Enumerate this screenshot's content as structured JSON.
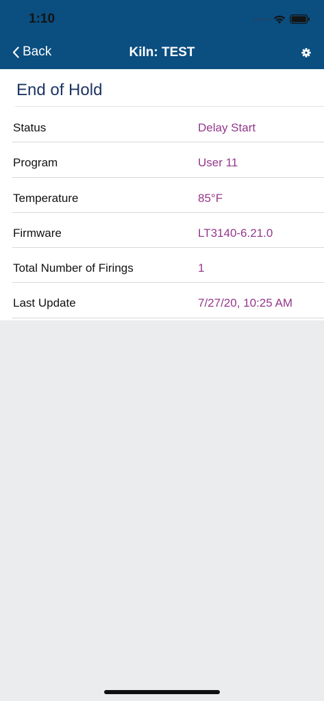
{
  "status_bar": {
    "time": "1:10"
  },
  "nav": {
    "back_label": "Back",
    "title": "Kiln: TEST",
    "settings_icon": "gear-icon"
  },
  "section": {
    "title": "End of Hold"
  },
  "details": [
    {
      "label": "Status",
      "value": "Delay Start"
    },
    {
      "label": "Program",
      "value": "User 11"
    },
    {
      "label": "Temperature",
      "value": "85°F"
    },
    {
      "label": "Firmware",
      "value": "LT3140-6.21.0"
    },
    {
      "label": "Total Number of Firings",
      "value": "1"
    },
    {
      "label": "Last Update",
      "value": "7/27/20, 10:25 AM"
    }
  ],
  "colors": {
    "header_bg": "#0b4e80",
    "title_color": "#1d3563",
    "value_color": "#93378c",
    "page_bg": "#ebecee"
  }
}
